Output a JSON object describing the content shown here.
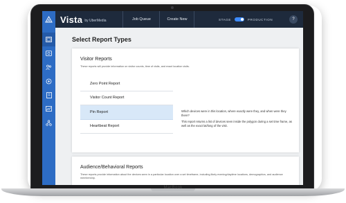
{
  "device": {
    "brand": "MacBook"
  },
  "header": {
    "app_title": "Vista",
    "byline": "by UberMedia",
    "nav": [
      "Job Queue",
      "Create New"
    ],
    "env_left": "STAGE",
    "env_right": "PRODUCTION",
    "help": "?"
  },
  "sidebar": {
    "icons": [
      "image-icon",
      "map-icon",
      "users-icon",
      "location-settings-icon",
      "building-icon",
      "chart-icon",
      "network-icon"
    ]
  },
  "page": {
    "title": "Select Report Types",
    "visitor": {
      "title": "Visitor Reports",
      "description": "These reports will provide information on visitor counts, time of visits, and exact location visits.",
      "items": [
        "Zero Point Report",
        "Visitor Count Report",
        "Pin Report",
        "Heartbeat Report"
      ],
      "selected": "Pin Report",
      "detail_1": "Which devices were in this location, where exactly were they, and when were they there?",
      "detail_2": "This report returns a list of devices seen inside the polygon during a set time frame, as well as the exact lat/long of the visit."
    },
    "audience": {
      "title": "Audience/Behavioral Reports",
      "description": "These reports provide information about the devices seen in a particular location over a set timeframe, including likely evening/daytime locations, demographics, and audience membership."
    }
  }
}
